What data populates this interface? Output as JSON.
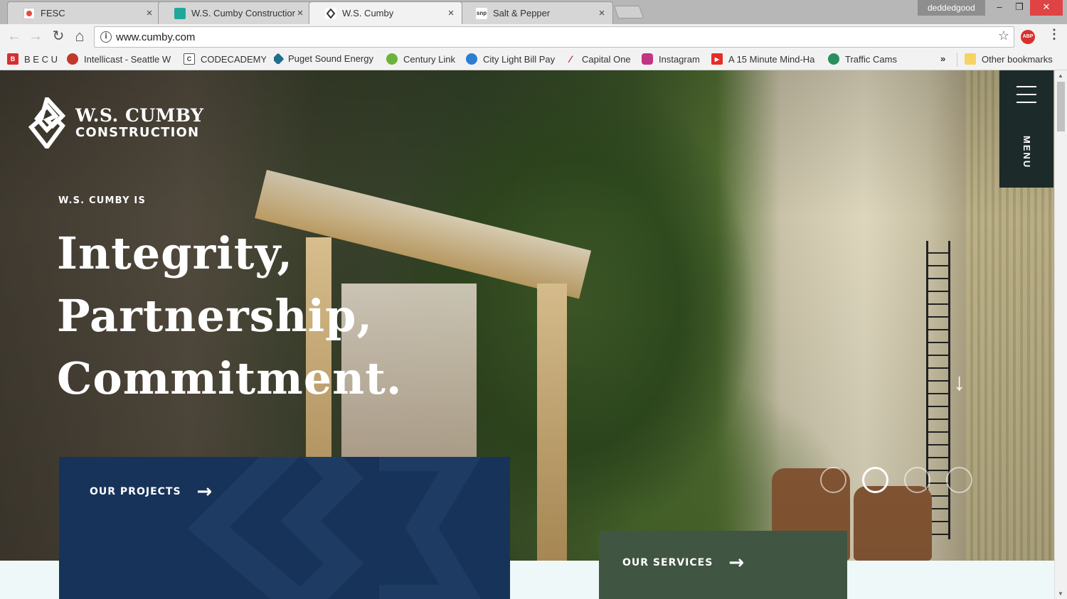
{
  "browser": {
    "tabs": [
      {
        "title": "FESC",
        "close": "×",
        "fav_color": "#ffffff",
        "fav_text": "",
        "active": false
      },
      {
        "title": "W.S. Cumby Construction",
        "close": "×",
        "fav_color": "#1fa899",
        "fav_text": "",
        "active": false
      },
      {
        "title": "W.S. Cumby",
        "close": "×",
        "fav_color": "#ffffff",
        "fav_text": "",
        "active": true
      },
      {
        "title": "Salt & Pepper",
        "close": "×",
        "fav_color": "#ffffff",
        "fav_text": "snp",
        "active": false
      }
    ],
    "profile": "deddedgood",
    "window_buttons": {
      "minimize": "–",
      "maximize": "❐",
      "close": "✕"
    },
    "nav": {
      "back": "←",
      "forward": "→",
      "reload": "↻",
      "home": "⌂"
    },
    "url": "www.cumby.com",
    "info_icon": "i",
    "star": "☆",
    "abp": "ABP",
    "menu": "⋮",
    "bookmarks": [
      {
        "label": "B E C U",
        "icon_text": "B",
        "icon_color": "#d62e2e"
      },
      {
        "label": "Intellicast - Seattle W",
        "icon_text": "",
        "icon_color": "#c0392b"
      },
      {
        "label": "CODECADEMY",
        "icon_text": "C",
        "icon_color": "#ffffff"
      },
      {
        "label": "Puget Sound Energy",
        "icon_text": "",
        "icon_color": "#1f6e8c"
      },
      {
        "label": "Century Link",
        "icon_text": "",
        "icon_color": "#6bb33a"
      },
      {
        "label": "City Light Bill Pay",
        "icon_text": "",
        "icon_color": "#2d7dd2"
      },
      {
        "label": "Capital One",
        "icon_text": "",
        "icon_color": "#b3223a"
      },
      {
        "label": "Instagram",
        "icon_text": "",
        "icon_color": "#c13584"
      },
      {
        "label": "A 15 Minute Mind-Ha",
        "icon_text": "▶",
        "icon_color": "#e52d27"
      },
      {
        "label": "Traffic Cams",
        "icon_text": "",
        "icon_color": "#2a8f5f"
      }
    ],
    "more": "»",
    "other_bookmarks": "Other bookmarks"
  },
  "site": {
    "logo_line1": "W.S. CUMBY",
    "logo_line2": "CONSTRUCTION",
    "kicker": "W.S. CUMBY IS",
    "headline": [
      "Integrity,",
      "Partnership,",
      "Commitment."
    ],
    "menu_label": "MENU",
    "down_arrow": "↓",
    "slides": {
      "count": 4,
      "active_index": 1
    },
    "cta_projects": "OUR PROJECTS",
    "cta_services": "OUR SERVICES",
    "cta_arrow": "→",
    "colors": {
      "projects": "#17335a",
      "services": "#405542",
      "menu_panel": "#1c2a2a"
    }
  }
}
